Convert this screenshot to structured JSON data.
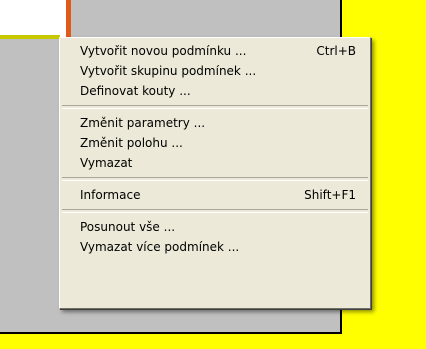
{
  "context_menu": {
    "items": [
      {
        "label": "Vytvořit novou podmínku ...",
        "shortcut": "Ctrl+B"
      },
      {
        "label": "Vytvořit skupinu podmínek ...",
        "shortcut": ""
      },
      {
        "label": "Definovat kouty ...",
        "shortcut": ""
      },
      {
        "label": "Změnit parametry ...",
        "shortcut": ""
      },
      {
        "label": "Změnit polohu ...",
        "shortcut": ""
      },
      {
        "label": "Vymazat",
        "shortcut": ""
      },
      {
        "label": "Informace",
        "shortcut": "Shift+F1"
      },
      {
        "label": "Posunout vše ...",
        "shortcut": ""
      },
      {
        "label": "Vymazat více podmínek ...",
        "shortcut": ""
      }
    ]
  },
  "colors": {
    "canvas_gray": "#c0c0c0",
    "highlight_yellow": "#ffff00",
    "accent_orange": "#e05a18",
    "menu_background": "#ece9d8"
  }
}
